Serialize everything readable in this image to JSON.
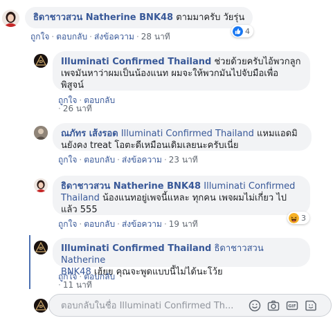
{
  "comments": [
    {
      "author": "ธิดาชาวสวน Natherine BNK48",
      "text": "ตามมาครับ วัยรุ่น",
      "like_label": "ถูกใจ",
      "reply_label": "ตอบกลับ",
      "translate_label": "ส่งข้อความ",
      "time": "28 นาที",
      "reaction_count": "4",
      "reaction_icon": "like-icon"
    },
    {
      "author": "Illuminati Confirmed Thailand",
      "text_line1": "ช่วยด้วยครับไอ้พวกลูก",
      "text_line2": "เพจมันหาว่าผมเป็นน้องแนท ผมจะให้พวกมันไปจับมือเพื่อ",
      "text_line3": "พิสูจน์",
      "like_label": "ถูกใจ",
      "reply_label": "ตอบกลับ",
      "time": "26 นาที"
    },
    {
      "author": "ณภัทร เส้งรอด",
      "mention": "Illuminati Confirmed Thailand",
      "text_line1": "แหมแอดมิ",
      "text_line2": "นยังคง treat โอตะดีเหมือนเดิมเลยนะครับเนี่ย",
      "like_label": "ถูกใจ",
      "reply_label": "ตอบกลับ",
      "translate_label": "ส่งข้อความ",
      "time": "23 นาที"
    },
    {
      "author": "ธิดาชาวสวน Natherine BNK48",
      "mention_part1": "Illuminati Confirmed",
      "mention_part2": "Thailand",
      "text_line2": "น้องแนทอยู่เพจนี้แหละ ทุกคน เพจผมไม่เกี่ยว ไป",
      "text_line3": "แล้ว 555",
      "like_label": "ถูกใจ",
      "reply_label": "ตอบกลับ",
      "translate_label": "ส่งข้อความ",
      "time": "19 นาที",
      "reaction_count": "3",
      "reaction_icon": "haha-icon"
    },
    {
      "author": "Illuminati Confirmed Thailand",
      "mention_part1": "ธิดาชาวสวน Natherine",
      "mention_part2": "BNK48",
      "text_line2": "เฮ้ยย คุณจะพูดแบบนี้ไม่ได้นะโว้ย",
      "like_label": "ถูกใจ",
      "reply_label": "ตอบกลับ",
      "time": "11 นาที"
    }
  ],
  "reply_box": {
    "placeholder": "ตอบกลับในชื่อ Illuminati Confirmed Th...",
    "icons": [
      "emoji-icon",
      "camera-icon",
      "gif-icon",
      "sticker-icon"
    ]
  },
  "colors": {
    "link": "#385898",
    "bubble": "#f2f3f5",
    "meta": "#606770",
    "thread_line": "#4b6fb1",
    "like_blue": "#1877f2",
    "haha_yellow": "#f7b125"
  }
}
